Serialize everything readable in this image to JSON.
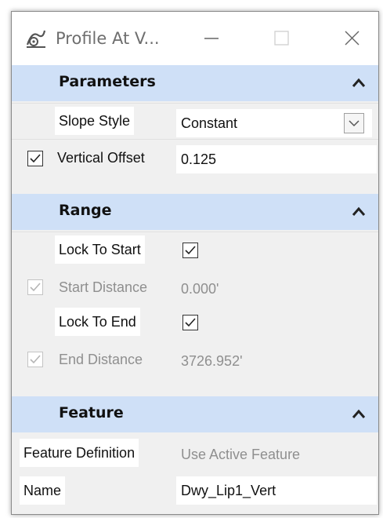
{
  "window": {
    "title": "Profile At V...",
    "minimize_icon": "minimize-icon",
    "maximize_icon": "maximize-icon",
    "close_icon": "close-icon"
  },
  "sections": {
    "parameters": {
      "title": "Parameters",
      "slope_style_label": "Slope Style",
      "slope_style_value": "Constant",
      "vertical_offset_label": "Vertical Offset",
      "vertical_offset_value": "0.125",
      "vertical_offset_checked": true
    },
    "range": {
      "title": "Range",
      "lock_to_start_label": "Lock To Start",
      "lock_to_start_checked": true,
      "start_distance_label": "Start Distance",
      "start_distance_value": "0.000'",
      "start_distance_checked": true,
      "lock_to_end_label": "Lock To End",
      "lock_to_end_checked": true,
      "end_distance_label": "End Distance",
      "end_distance_value": "3726.952'",
      "end_distance_checked": true
    },
    "feature": {
      "title": "Feature",
      "feature_definition_label": "Feature Definition",
      "feature_definition_value": "Use Active Feature",
      "name_label": "Name",
      "name_value": "Dwy_Lip1_Vert"
    }
  },
  "colors": {
    "section_header_bg": "#cfe0f7",
    "panel_bg": "#f0f0f0",
    "disabled_text": "#8f8f8f"
  }
}
